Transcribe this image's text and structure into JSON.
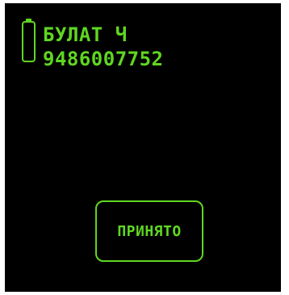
{
  "colors": {
    "accent": "#5fd621",
    "background": "#000000"
  },
  "status": {
    "battery_icon": "battery-icon"
  },
  "contact": {
    "name": "БУЛАТ Ч",
    "phone": "9486007752"
  },
  "actions": {
    "accept_label": "ПРИНЯТО"
  }
}
